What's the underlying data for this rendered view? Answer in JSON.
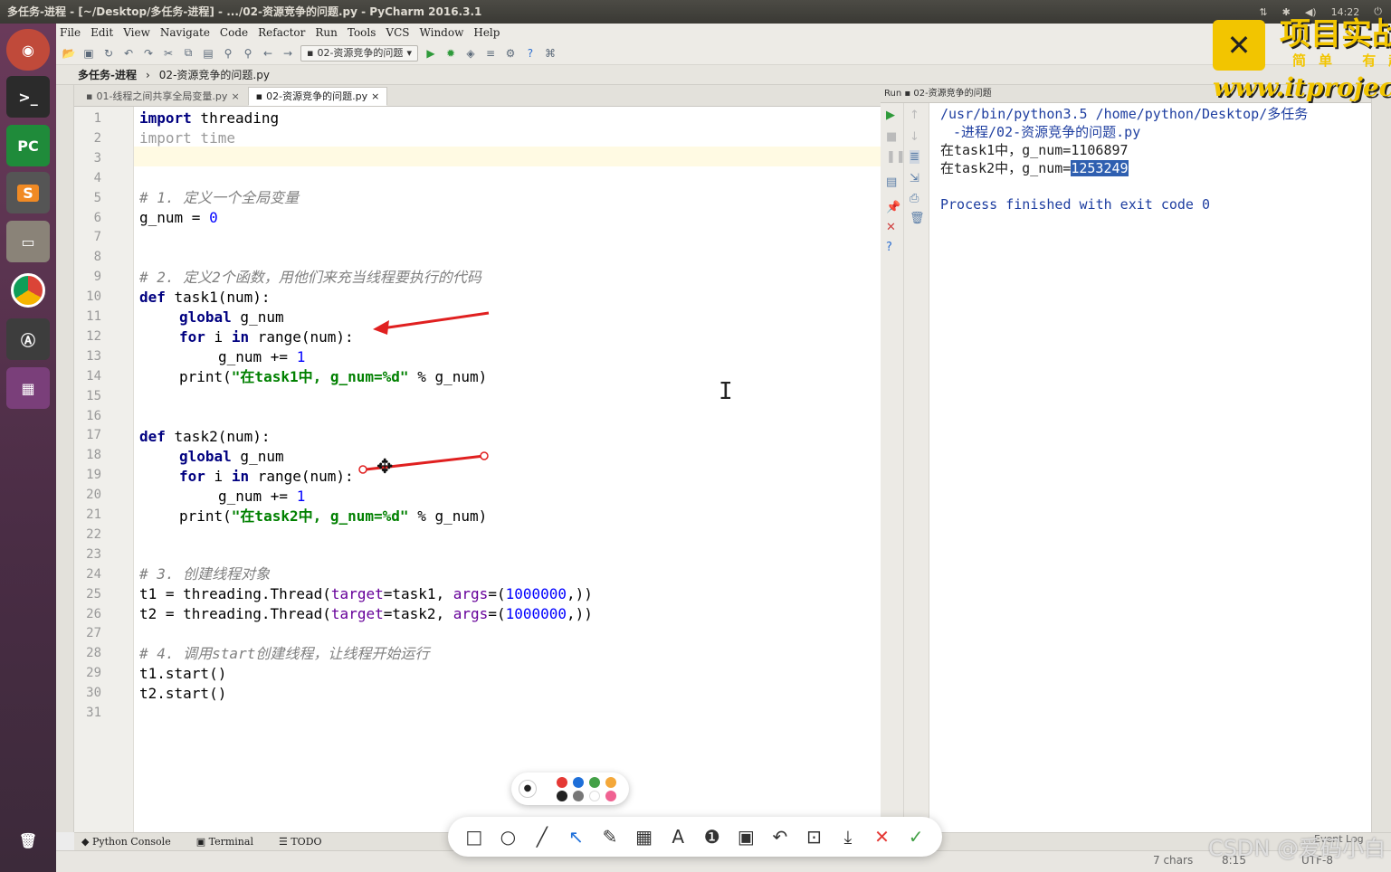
{
  "window": {
    "title": "多任务-进程 - [~/Desktop/多任务-进程] - .../02-资源竞争的问题.py - PyCharm 2016.3.1",
    "clock": "14:22"
  },
  "menu": [
    "File",
    "Edit",
    "View",
    "Navigate",
    "Code",
    "Refactor",
    "Run",
    "Tools",
    "VCS",
    "Window",
    "Help"
  ],
  "toolbar": {
    "run_config": "02-资源竞争的问题"
  },
  "breadcrumb": {
    "project": "多任务-进程",
    "file": "02-资源竞争的问题.py"
  },
  "tabs": [
    {
      "label": "01-线程之间共享全局变量.py"
    },
    {
      "label": "02-资源竞争的问题.py"
    }
  ],
  "editor": {
    "line_numbers": [
      "1",
      "2",
      "3",
      "4",
      "5",
      "6",
      "7",
      "8",
      "9",
      "10",
      "11",
      "12",
      "13",
      "14",
      "15",
      "16",
      "17",
      "18",
      "19",
      "20",
      "21",
      "22",
      "23",
      "24",
      "25",
      "26",
      "27",
      "28",
      "29",
      "30",
      "31"
    ],
    "code": {
      "l1a": "import",
      "l1b": " threading",
      "l2": "import time",
      "l5": "# 1. 定义一个全局变量",
      "l6a": "g_num = ",
      "l6b": "0",
      "l8": "# 2. 定义2个函数，用他们来充当线程要执行的代码",
      "l10a": "def",
      "l10b": " task1(num):",
      "l11a": "global",
      "l11b": " g_num",
      "l12a": "for",
      "l12b": " i ",
      "l12c": "in",
      "l12d": " range(num):",
      "l13a": "g_num += ",
      "l13b": "1",
      "l14a": "print(",
      "l14b": "\"在task1中, g_num=%d\"",
      "l14c": " % g_num)",
      "l17a": "def",
      "l17b": " task2(num):",
      "l18a": "global",
      "l18b": " g_num",
      "l19a": "for",
      "l19b": " i ",
      "l19c": "in",
      "l19d": " range(num):",
      "l20a": "g_num += ",
      "l20b": "1",
      "l21a": "print(",
      "l21b": "\"在task2中, g_num=%d\"",
      "l21c": " % g_num)",
      "l24": "# 3. 创建线程对象",
      "l25a": "t1 = threading.Thread(",
      "l25b": "target",
      "l25c": "=task1, ",
      "l25d": "args",
      "l25e": "=(",
      "l25f": "1000000",
      "l25g": ",))",
      "l26a": "t2 = threading.Thread(",
      "l26b": "target",
      "l26c": "=task2, ",
      "l26d": "args",
      "l26e": "=(",
      "l26f": "1000000",
      "l26g": ",))",
      "l28": "# 4. 调用start创建线程，让线程开始运行",
      "l29": "t1.start()",
      "l30": "t2.start()"
    }
  },
  "run": {
    "header_label": "Run",
    "header_config": "02-资源竞争的问题",
    "console": {
      "cmd1": "/usr/bin/python3.5 /home/python/Desktop/多任务",
      "cmd2": "-进程/02-资源竞争的问题.py",
      "out1": "在task1中，g_num=1106897",
      "out2_prefix": "在task2中，g_num=",
      "out2_value": "1253249",
      "finished": "Process finished with exit code 0"
    }
  },
  "bottom_tools": [
    "Python Console",
    "Terminal",
    "TODO"
  ],
  "status": {
    "chars": "7 chars",
    "position": "8:15",
    "encoding": "UTF-8",
    "event_log": "Event Log"
  },
  "watermark": {
    "title": "项目实战",
    "sub": "简单 有趣",
    "url": "www.itproject"
  },
  "csdn": "CSDN @爱码小白",
  "colors": {
    "keyword": "#000080",
    "string": "#008000",
    "number": "#0000ff",
    "comment": "#808080",
    "selection": "#2f5fb0",
    "arrow": "#e02020"
  }
}
